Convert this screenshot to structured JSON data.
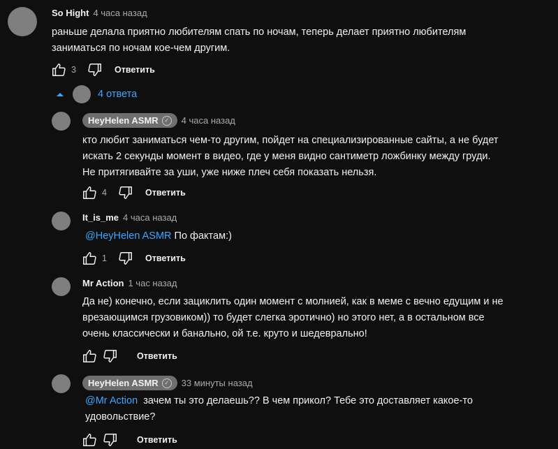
{
  "comment": {
    "author": "So Hight",
    "time": "4 часа назад",
    "text_line1": "раньше делала приятно любителям спать по ночам, теперь делает приятно любителям",
    "text_line2": "заниматься по ночам кое-чем другим.",
    "likes": "3",
    "reply_label": "Ответить"
  },
  "replies_toggle": {
    "label": "4 ответа"
  },
  "replies": [
    {
      "author": "HeyHelen ASMR",
      "time": "4 часа назад",
      "lines": [
        "кто любит заниматься чем-то другим, пойдет на специализированные сайты, а не будет",
        "искать 2 секунды момент в видео, где у меня видно сантиметр ложбинку между груди.",
        "Не притягивайте за уши, уже ниже плеч себя показать нельзя."
      ],
      "likes": "4",
      "reply_label": "Ответить"
    },
    {
      "author": "It_is_me",
      "time": "4 часа назад",
      "mention": "@HeyHelen ASMR",
      "text": " По фактам:)",
      "likes": "1",
      "reply_label": "Ответить"
    },
    {
      "author": "Mr Action",
      "time": "1 час назад",
      "lines": [
        "Да не) конечно, если зациклить один момент с молнией, как в меме с вечно едущим и не",
        "врезающимся грузовиком)) то будет слегка эротично) но этого нет, а в остальном все",
        "очень классически и банально, ой т.е. круто и шедеврально!"
      ],
      "likes": "",
      "reply_label": "Ответить"
    },
    {
      "author": "HeyHelen ASMR",
      "time": "33 минуты назад",
      "mention": "@Mr Action",
      "text_line1": "  зачем ты это делаешь?? В чем прикол? Тебе это доставляет какое-то",
      "text_line2": "удовольствие?",
      "likes": "",
      "reply_label": "Ответить"
    }
  ],
  "icons": {
    "like": "thumbs-up-icon",
    "dislike": "thumbs-down-icon",
    "verified": "check-circle-icon",
    "caret": "caret-up-icon"
  },
  "colors": {
    "background": "#0f0f0f",
    "link": "#3ea6ff",
    "secondary_text": "#aaaaaa"
  }
}
